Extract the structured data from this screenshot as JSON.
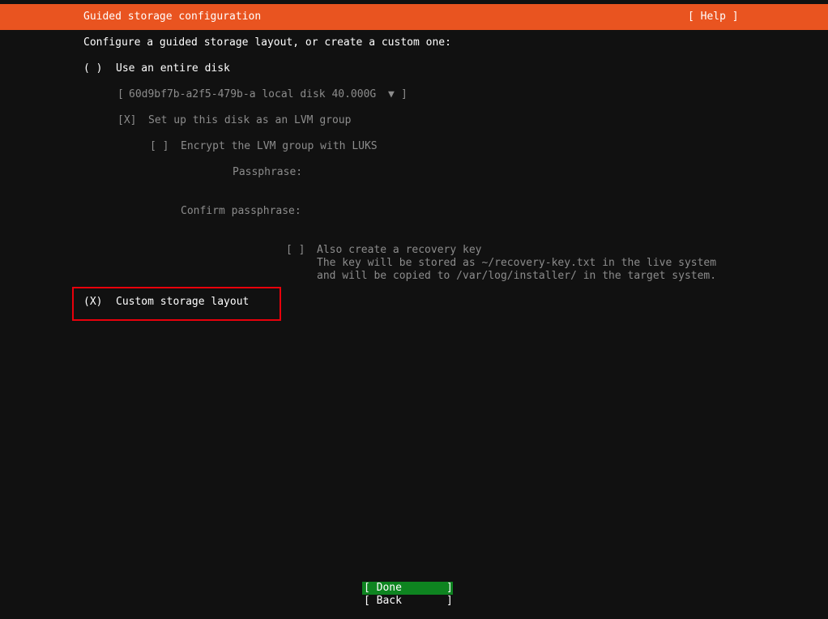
{
  "header": {
    "title": "Guided storage configuration",
    "help": "[ Help ]"
  },
  "intro": "Configure a guided storage layout, or create a custom one:",
  "options": {
    "entire_disk": {
      "radio": "( )",
      "label": "Use an entire disk"
    },
    "disk_select": {
      "open": "[",
      "value": "60d9bf7b-a2f5-479b-a local disk 40.000G",
      "arrow": "▼",
      "close": "]"
    },
    "lvm": {
      "checkbox": "[X]",
      "label": "Set up this disk as an LVM group"
    },
    "luks": {
      "checkbox": "[ ]",
      "label": "Encrypt the LVM group with LUKS"
    },
    "passphrase_label": "Passphrase:",
    "confirm_label": "Confirm passphrase:",
    "recovery": {
      "checkbox": "[ ]",
      "label": "Also create a recovery key",
      "help1": "The key will be stored as ~/recovery-key.txt in the live system",
      "help2": "and will be copied to /var/log/installer/ in the target system."
    },
    "custom": {
      "radio": "(X)",
      "label": "Custom storage layout"
    }
  },
  "buttons": {
    "done": {
      "open": "[ Done",
      "close": "]"
    },
    "back": {
      "open": "[ Back",
      "close": "]"
    }
  },
  "colors": {
    "accent": "#e95420",
    "focus": "#0e8420",
    "highlight": "#e8000b"
  }
}
